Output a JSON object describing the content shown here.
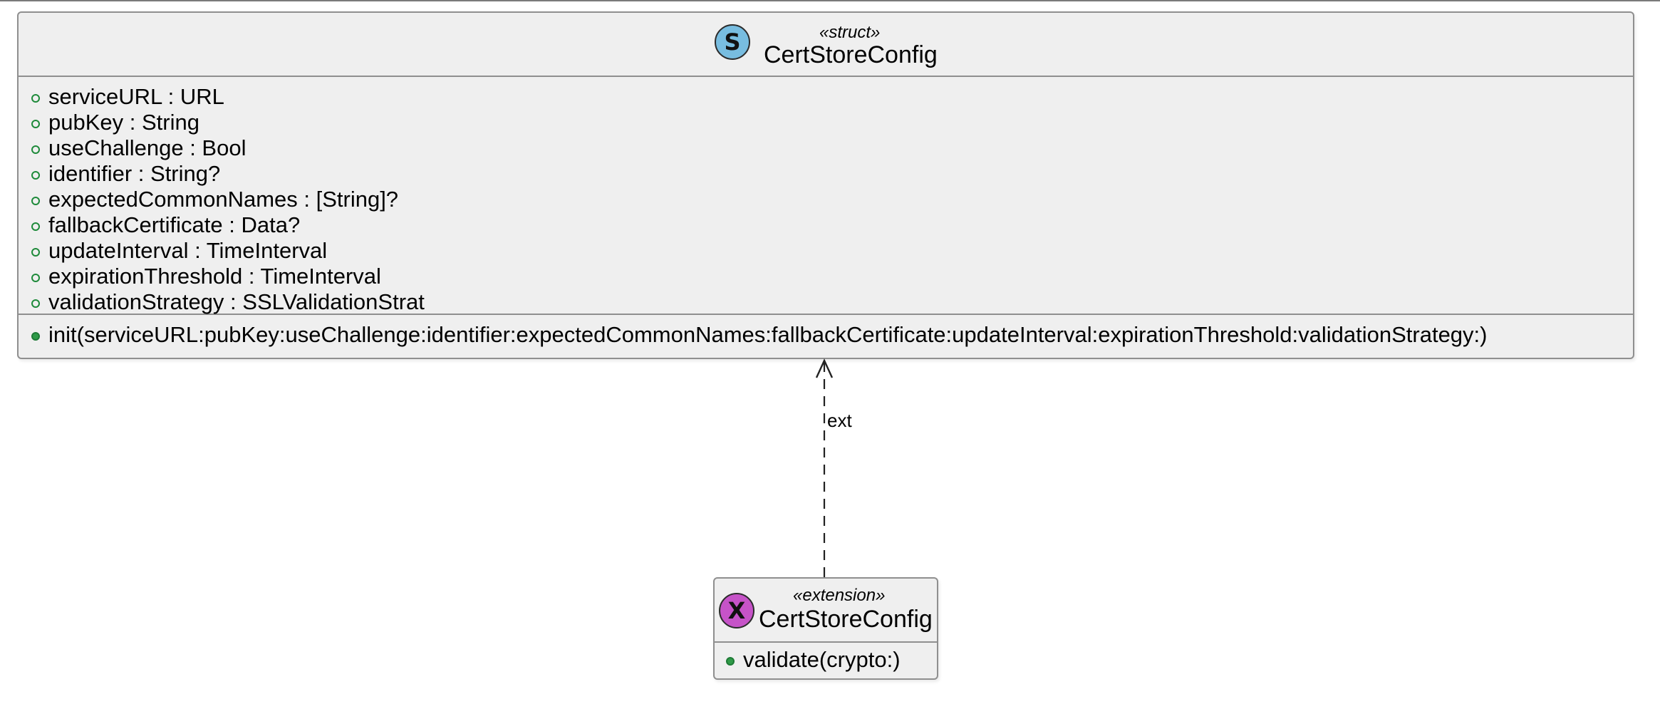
{
  "classes": {
    "struct": {
      "stereotype": "«struct»",
      "badge_letter": "S",
      "badge_color": "#78bde0",
      "name": "CertStoreConfig",
      "fields": [
        "serviceURL : URL",
        "pubKey : String",
        "useChallenge : Bool",
        "identifier : String?",
        "expectedCommonNames : [String]?",
        "fallbackCertificate : Data?",
        "updateInterval : TimeInterval",
        "expirationThreshold : TimeInterval",
        "validationStrategy : SSLValidationStrat"
      ],
      "methods": [
        "init(serviceURL:pubKey:useChallenge:identifier:expectedCommonNames:fallbackCertificate:updateInterval:expirationThreshold:validationStrategy:)"
      ]
    },
    "extension": {
      "stereotype": "«extension»",
      "badge_letter": "X",
      "badge_color": "#c653c8",
      "name": "CertStoreConfig",
      "methods": [
        "validate(crypto:)"
      ]
    }
  },
  "relation": {
    "label": "ext",
    "style": "dashed",
    "arrow": "open",
    "from": "extension",
    "to": "struct"
  }
}
